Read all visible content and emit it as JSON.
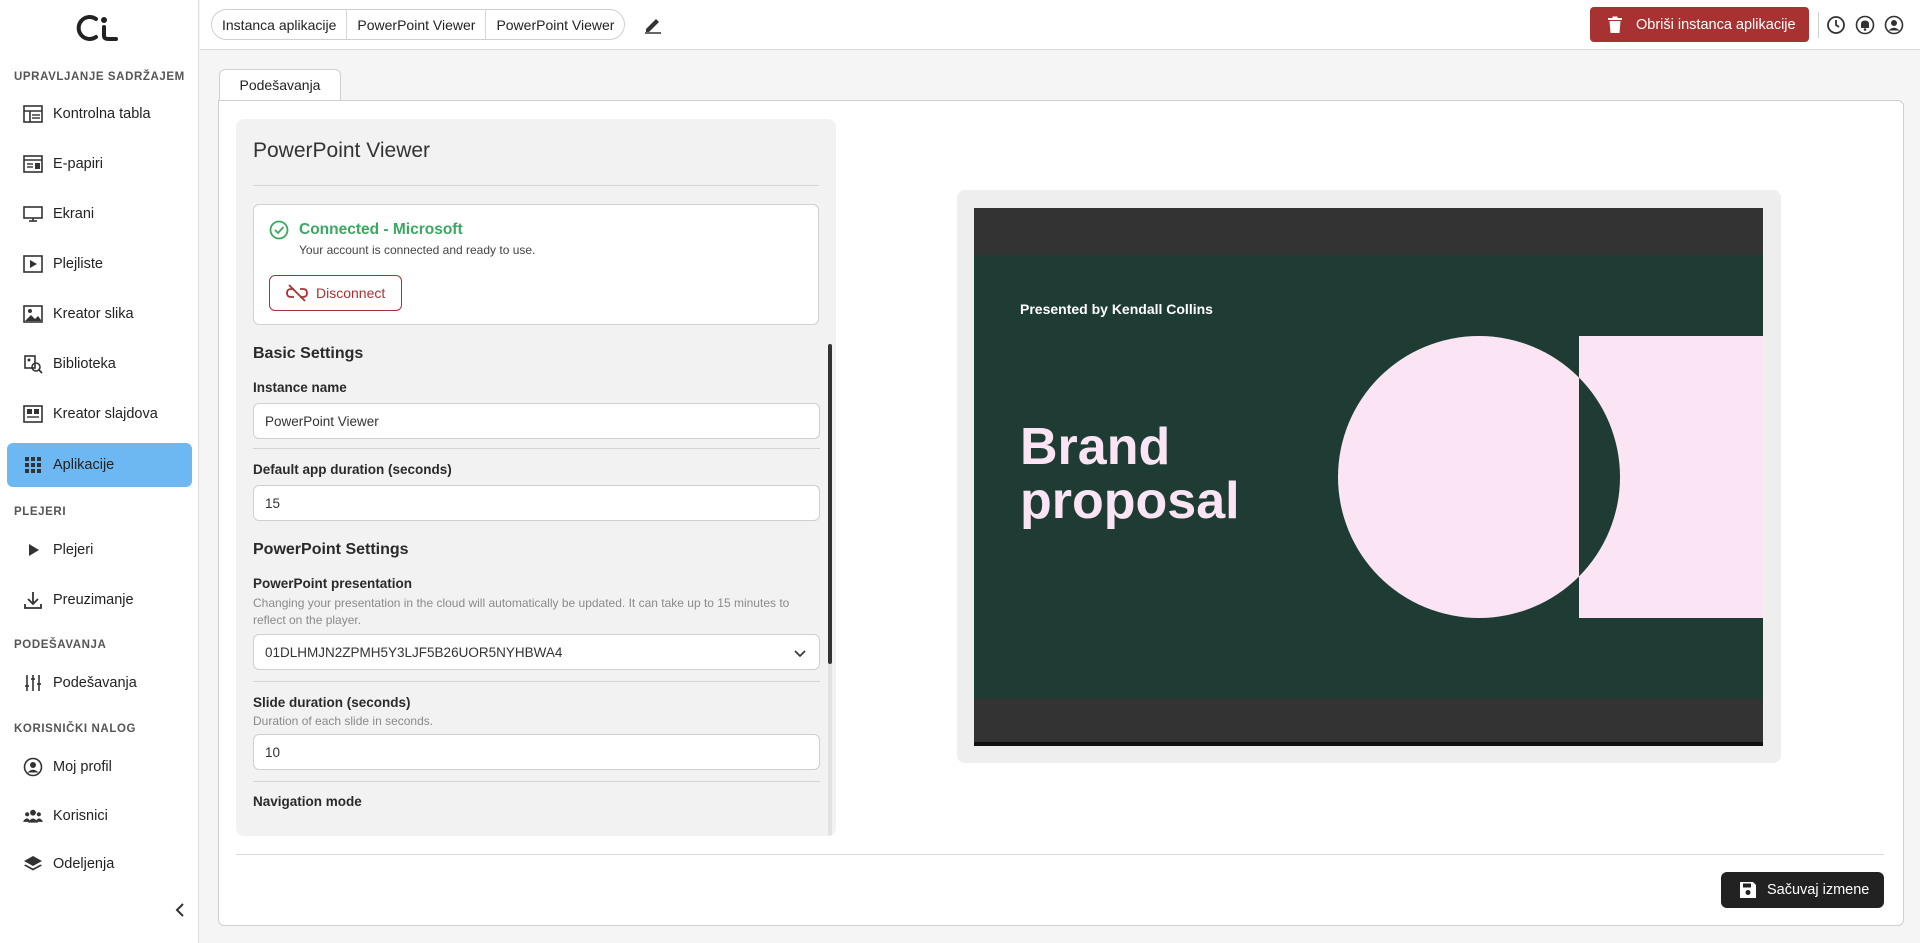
{
  "sidebar": {
    "sections": [
      "UPRAVLJANJE SADRŽAJEM",
      "PLEJERI",
      "PODEŠAVANJA",
      "KORISNIČKI NALOG"
    ],
    "items": [
      {
        "label": "Kontrolna tabla",
        "icon": "dashboard-icon"
      },
      {
        "label": "E-papiri",
        "icon": "epaper-icon"
      },
      {
        "label": "Ekrani",
        "icon": "monitor-icon"
      },
      {
        "label": "Plejliste",
        "icon": "playlist-icon"
      },
      {
        "label": "Kreator slika",
        "icon": "image-icon"
      },
      {
        "label": "Biblioteka",
        "icon": "library-icon"
      },
      {
        "label": "Kreator slajdova",
        "icon": "slides-icon"
      },
      {
        "label": "Aplikacije",
        "icon": "apps-grid-icon"
      },
      {
        "label": "Plejeri",
        "icon": "play-icon"
      },
      {
        "label": "Preuzimanje",
        "icon": "download-icon"
      },
      {
        "label": "Podešavanja",
        "icon": "sliders-icon"
      },
      {
        "label": "Moj profil",
        "icon": "user-circle-icon"
      },
      {
        "label": "Korisnici",
        "icon": "users-icon"
      },
      {
        "label": "Odeljenja",
        "icon": "layers-icon"
      }
    ],
    "active_index": 7
  },
  "topbar": {
    "breadcrumb": [
      "Instanca aplikacije",
      "PowerPoint Viewer",
      "PowerPoint Viewer"
    ],
    "delete_label": "Obriši instanca aplikacije"
  },
  "tab": {
    "label": "Podešavanja"
  },
  "card": {
    "title": "PowerPoint Viewer",
    "connection": {
      "title": "Connected - Microsoft",
      "subtitle": "Your account is connected and ready to use.",
      "disconnect_label": "Disconnect"
    },
    "basic": {
      "heading": "Basic Settings",
      "instance_name_label": "Instance name",
      "instance_name_value": "PowerPoint Viewer",
      "duration_label": "Default app duration (seconds)",
      "duration_value": "15"
    },
    "ppt": {
      "heading": "PowerPoint Settings",
      "presentation_label": "PowerPoint presentation",
      "presentation_help": "Changing your presentation in the cloud will automatically be updated. It can take up to 15 minutes to reflect on the player.",
      "presentation_value": "01DLHMJN2ZPMH5Y3LJF5B26UOR5NYHBWA4",
      "slide_duration_label": "Slide duration (seconds)",
      "slide_duration_help": "Duration of each slide in seconds.",
      "slide_duration_value": "10",
      "navigation_label": "Navigation mode"
    }
  },
  "preview": {
    "presented_by": "Presented by Kendall Collins",
    "title": "Brand proposal",
    "colors": {
      "bg": "#1f3c34",
      "accent": "#fbe4f4",
      "frame": "#333333"
    }
  },
  "save_label": "Sačuvaj izmene",
  "colors": {
    "active_nav": "#6db8f2",
    "danger": "#a83232",
    "success": "#3aa860"
  }
}
